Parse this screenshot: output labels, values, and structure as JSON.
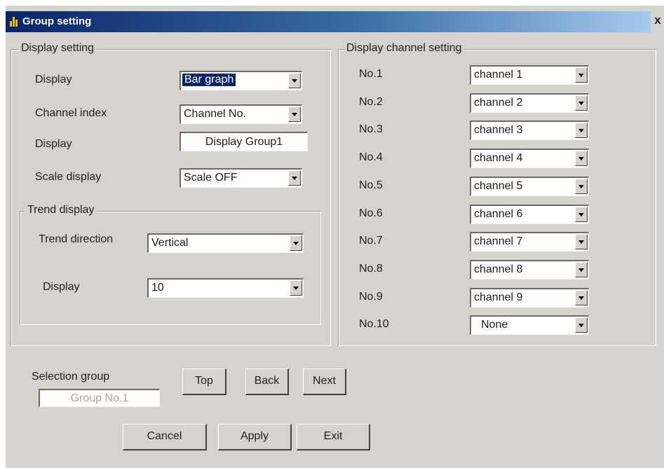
{
  "window": {
    "title": "Group setting",
    "close_glyph": "x"
  },
  "display_setting": {
    "legend": "Display setting",
    "display_label": "Display",
    "display_value": "Bar graph",
    "channel_index_label": "Channel index",
    "channel_index_value": "Channel No.",
    "display_name_label": "Display",
    "display_name_value": "Display Group1",
    "scale_display_label": "Scale display",
    "scale_display_value": "Scale OFF"
  },
  "trend_display": {
    "legend": "Trend display",
    "direction_label": "Trend direction",
    "direction_value": "Vertical",
    "display_label": "Display",
    "display_value": "10"
  },
  "channel_setting": {
    "legend": "Display channel setting",
    "rows": [
      {
        "label": "No.1",
        "value": "channel 1"
      },
      {
        "label": "No.2",
        "value": "channel 2"
      },
      {
        "label": "No.3",
        "value": "channel 3"
      },
      {
        "label": "No.4",
        "value": "channel 4"
      },
      {
        "label": "No.5",
        "value": "channel 5"
      },
      {
        "label": "No.6",
        "value": "channel 6"
      },
      {
        "label": "No.7",
        "value": "channel 7"
      },
      {
        "label": "No.8",
        "value": "channel 8"
      },
      {
        "label": "No.9",
        "value": "channel 9"
      },
      {
        "label": "No.10",
        "value": "None"
      }
    ]
  },
  "selection_group": {
    "label": "Selection group",
    "value": "Group No.1"
  },
  "nav_buttons": {
    "top": "Top",
    "back": "Back",
    "next": "Next"
  },
  "action_buttons": {
    "cancel": "Cancel",
    "apply": "Apply",
    "exit": "Exit"
  },
  "colors": {
    "title_bar": "#0a246a",
    "face": "#d6d3ce",
    "selection": "#0a246a"
  },
  "icons": {
    "app": "bar-chart-icon",
    "close": "close-icon",
    "dropdown": "chevron-down-icon"
  }
}
